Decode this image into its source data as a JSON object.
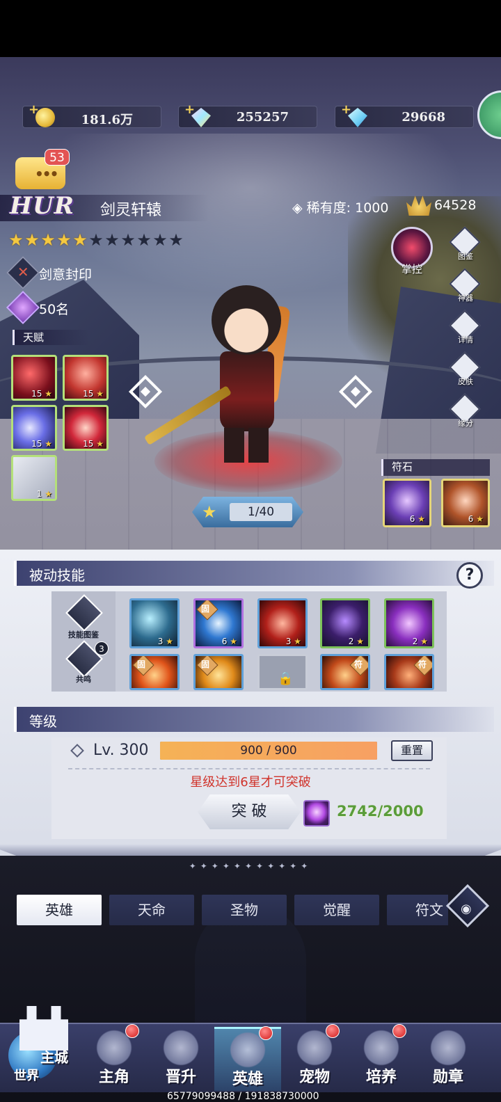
{
  "resources": {
    "gold": "181.6万",
    "gem": "255257",
    "diamond": "29668"
  },
  "hero": {
    "chat_badge": "53",
    "rarity_tier": "HUR",
    "name": "剑灵轩辕",
    "rarity_label": "稀有度:",
    "rarity_value": "1000",
    "power": "64528",
    "stars_total": 11,
    "stars_filled": 5,
    "title": "剑意封印",
    "rank": "50名"
  },
  "talent": {
    "header": "天赋",
    "skills": [
      {
        "level": "15",
        "icon": "crimson-slash-icon"
      },
      {
        "level": "15",
        "icon": "red-aura-icon"
      },
      {
        "level": "15",
        "icon": "violet-wave-icon"
      },
      {
        "level": "15",
        "icon": "blade-strike-icon"
      },
      {
        "level": "1",
        "icon": "sword-icon"
      }
    ]
  },
  "side_menu": {
    "control": "掌控",
    "items": [
      "图鉴",
      "神器",
      "详情",
      "皮肤",
      "缘分"
    ]
  },
  "rune": {
    "header": "符石",
    "items": [
      {
        "level": "6",
        "icon": "violet-rune-icon"
      },
      {
        "level": "6",
        "icon": "hooded-rune-icon"
      }
    ]
  },
  "ascension": "1/40",
  "passive": {
    "header": "被动技能",
    "help": "?",
    "codex_label": "技能图鉴",
    "resonance_label": "共鸣",
    "resonance_badge": "3",
    "fixed_tag": "固",
    "exclusive_tag": "符",
    "skills_row1": [
      {
        "level": "3",
        "border": "#5fa0d8"
      },
      {
        "level": "6",
        "border": "#b070e0",
        "tag": "固"
      },
      {
        "level": "3",
        "border": "#5fa0d8"
      },
      {
        "level": "2",
        "border": "#7dc25a"
      },
      {
        "level": "2",
        "border": "#7dc25a"
      }
    ]
  },
  "level": {
    "header": "等级",
    "label": "Lv. 300",
    "exp": "900 / 900",
    "exp_fraction": 1.0,
    "reset": "重置",
    "warning": "星级达到6星才可突破",
    "break_label": "突 破",
    "materials": "2742/2000"
  },
  "tabs": [
    "英雄",
    "天命",
    "圣物",
    "觉醒",
    "符文"
  ],
  "nav": {
    "world_main": "主城",
    "world_sub": "世界",
    "items": [
      "主角",
      "晋升",
      "英雄",
      "宠物",
      "培养",
      "勋章"
    ]
  },
  "footer": "65779099488 / 191838730000"
}
